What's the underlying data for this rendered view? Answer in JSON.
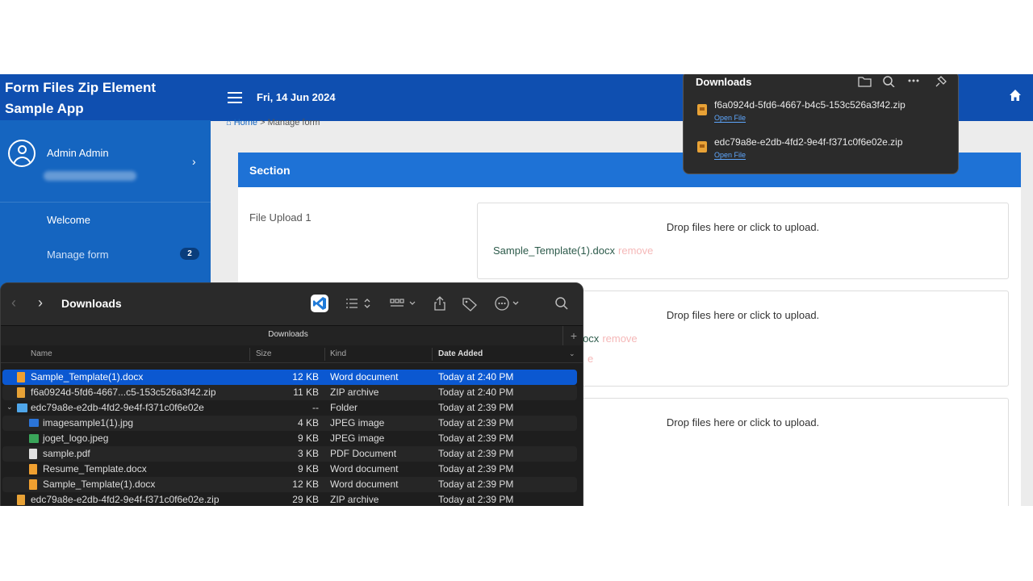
{
  "app": {
    "title": "Form Files Zip Element Sample App",
    "date": "Fri, 14 Jun 2024",
    "user_name": "Admin Admin",
    "nav": [
      {
        "label": "Welcome"
      },
      {
        "label": "Manage form",
        "badge": "2"
      }
    ],
    "breadcrumb": {
      "home": "Home",
      "separator": ">",
      "current": "Manage form"
    },
    "section_title": "Section",
    "field_label": "File Upload 1",
    "dropzones": [
      {
        "prompt": "Drop files here or click to upload.",
        "file": "Sample_Template(1).docx",
        "remove": "remove"
      },
      {
        "prompt": "Drop files here or click to upload.",
        "file": "e.docx",
        "remove": "remove",
        "remove2": "e"
      },
      {
        "prompt": "Drop files here or click to upload."
      }
    ]
  },
  "downloads_popup": {
    "title": "Downloads",
    "icons": [
      "folder-icon",
      "search-icon",
      "more-icon",
      "pin-icon"
    ],
    "items": [
      {
        "name": "f6a0924d-5fd6-4667-b4c5-153c526a3f42.zip",
        "action": "Open File"
      },
      {
        "name": "edc79a8e-e2db-4fd2-9e4f-f371c0f6e02e.zip",
        "action": "Open File"
      }
    ]
  },
  "finder": {
    "title": "Downloads",
    "tab": "Downloads",
    "columns": {
      "name": "Name",
      "size": "Size",
      "kind": "Kind",
      "date": "Date Added"
    },
    "rows": [
      {
        "name": "Sample_Template(1).docx",
        "size": "12 KB",
        "kind": "Word document",
        "date": "Today at 2:40 PM",
        "icon": "docx",
        "indent": 0,
        "selected": true
      },
      {
        "name": "f6a0924d-5fd6-4667...c5-153c526a3f42.zip",
        "size": "11 KB",
        "kind": "ZIP archive",
        "date": "Today at 2:40 PM",
        "icon": "zip",
        "indent": 0
      },
      {
        "name": "edc79a8e-e2db-4fd2-9e4f-f371c0f6e02e",
        "size": "--",
        "kind": "Folder",
        "date": "Today at 2:39 PM",
        "icon": "folder",
        "indent": 0,
        "expanded": true
      },
      {
        "name": "imagesample1(1).jpg",
        "size": "4 KB",
        "kind": "JPEG image",
        "date": "Today at 2:39 PM",
        "icon": "jpg",
        "indent": 1
      },
      {
        "name": "joget_logo.jpeg",
        "size": "9 KB",
        "kind": "JPEG image",
        "date": "Today at 2:39 PM",
        "icon": "logo",
        "indent": 1
      },
      {
        "name": "sample.pdf",
        "size": "3 KB",
        "kind": "PDF Document",
        "date": "Today at 2:39 PM",
        "icon": "pdf",
        "indent": 1
      },
      {
        "name": "Resume_Template.docx",
        "size": "9 KB",
        "kind": "Word document",
        "date": "Today at 2:39 PM",
        "icon": "docx",
        "indent": 1
      },
      {
        "name": "Sample_Template(1).docx",
        "size": "12 KB",
        "kind": "Word document",
        "date": "Today at 2:39 PM",
        "icon": "docx",
        "indent": 1
      },
      {
        "name": "edc79a8e-e2db-4fd2-9e4f-f371c0f6e02e.zip",
        "size": "29 KB",
        "kind": "ZIP archive",
        "date": "Today at 2:39 PM",
        "icon": "zip",
        "indent": 0
      }
    ]
  },
  "colors": {
    "primary": "#1565c0",
    "topbar": "#0f4fb0",
    "section_header": "#1e72d6",
    "selection": "#0b58d1"
  }
}
